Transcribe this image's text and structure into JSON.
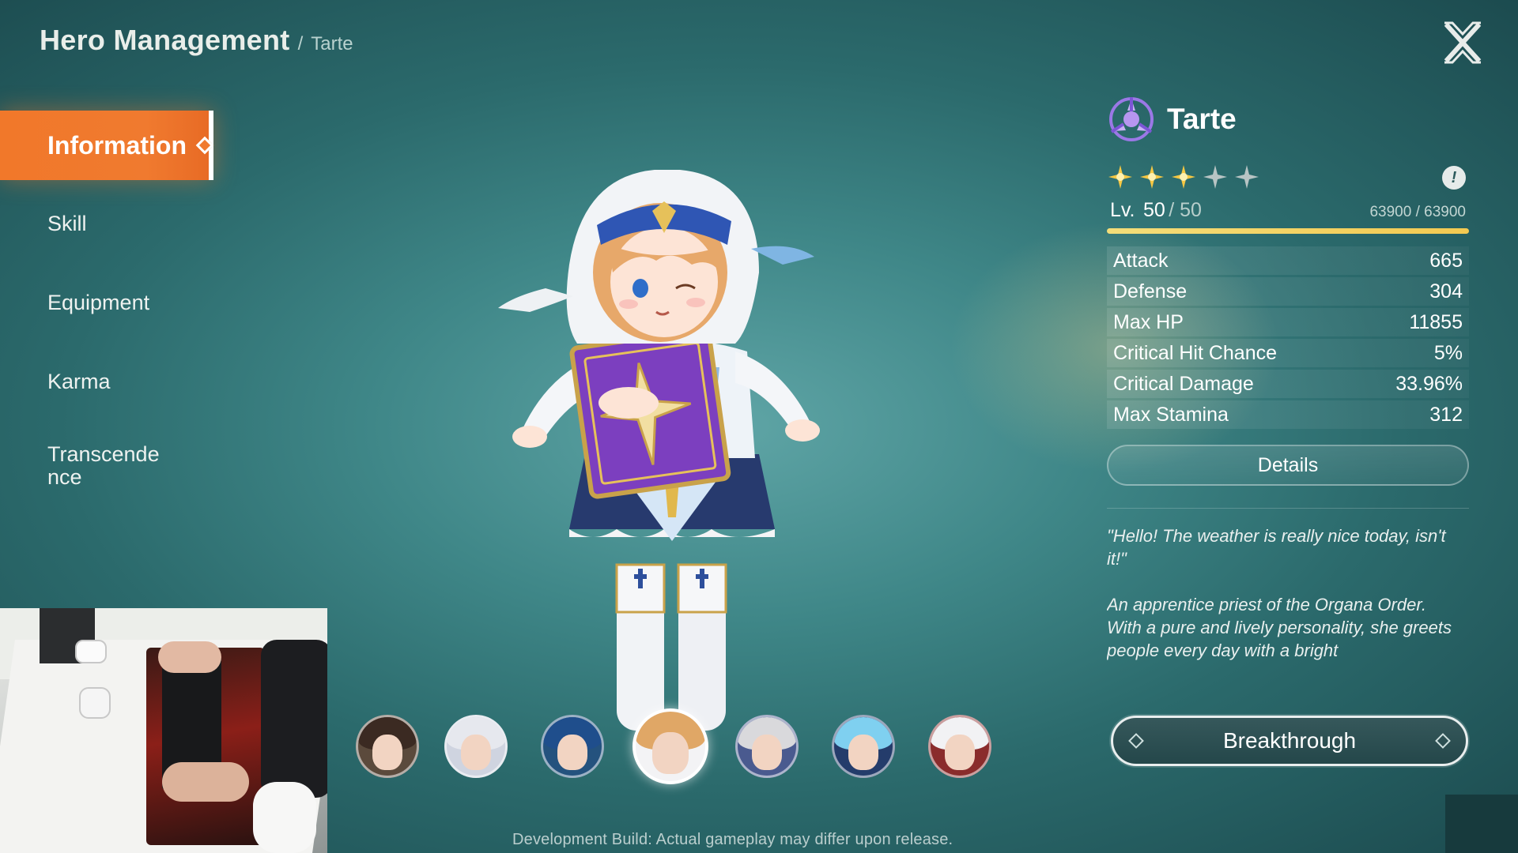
{
  "header": {
    "title": "Hero Management",
    "separator": "/",
    "breadcrumb": "Tarte"
  },
  "nav": {
    "items": [
      {
        "label": "Information",
        "active": true
      },
      {
        "label": "Skill"
      },
      {
        "label": "Equipment"
      },
      {
        "label": "Karma"
      },
      {
        "label": "Transcende\nnce"
      }
    ]
  },
  "hero": {
    "name": "Tarte",
    "class_icon": "class-emblem-icon",
    "stars_filled": 3,
    "stars_total": 5,
    "info_label": "!",
    "level_label": "Lv.",
    "level": "50",
    "level_max": "/ 50",
    "exp_text": "63900 / 63900",
    "exp_fraction": 1.0
  },
  "stats": [
    {
      "label": "Attack",
      "value": "665"
    },
    {
      "label": "Defense",
      "value": "304"
    },
    {
      "label": "Max HP",
      "value": "11855"
    },
    {
      "label": "Critical Hit Chance",
      "value": "5%"
    },
    {
      "label": "Critical Damage",
      "value": "33.96%"
    },
    {
      "label": "Max Stamina",
      "value": "312"
    }
  ],
  "details_label": "Details",
  "description": {
    "quote": "\"Hello! The weather is really nice today, isn't it!\"",
    "bio": "An apprentice priest of the Organa Order.\nWith a pure and lively personality, she greets people every day with a bright"
  },
  "breakthrough_label": "Breakthrough",
  "roster": [
    {
      "name": "hero-portrait-1",
      "hair": "#3b2a22",
      "selected": false
    },
    {
      "name": "hero-portrait-2",
      "hair": "#e6e8ee",
      "selected": false
    },
    {
      "name": "hero-portrait-3",
      "hair": "#1f4e8c",
      "selected": false
    },
    {
      "name": "hero-portrait-tarte",
      "hair": "#e0a766",
      "selected": true
    },
    {
      "name": "hero-portrait-5",
      "hair": "#d9d9dc",
      "selected": false
    },
    {
      "name": "hero-portrait-6",
      "hair": "#7fd0f0",
      "selected": false
    },
    {
      "name": "hero-portrait-7",
      "hair": "#f2f2f4",
      "selected": false
    }
  ],
  "footer_note": "Development Build: Actual gameplay may differ upon release.",
  "colors": {
    "accent": "#f07a2f",
    "star_filled": "#f6c843",
    "star_empty": "#b8c4c4",
    "exp_bar": "#f3c951"
  }
}
